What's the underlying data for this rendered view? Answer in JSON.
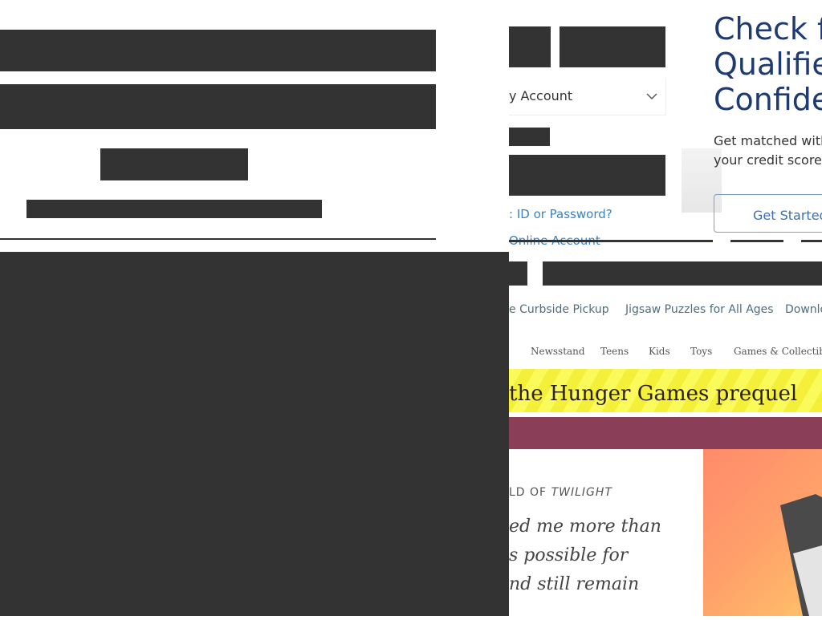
{
  "account_select": {
    "value": "y Account"
  },
  "links": {
    "forgot": ": ID or Password?",
    "create": "Online Account"
  },
  "ad": {
    "title_lines": [
      "Check fo",
      "Qualified",
      "Confide"
    ],
    "body_lines": [
      "Get matched with g",
      "your credit score."
    ],
    "cta": "Get Started"
  },
  "nav_primary": [
    "e Curbside Pickup",
    "Jigsaw Puzzles for All Ages",
    "Downlo"
  ],
  "nav_secondary": [
    "Newsstand",
    "Teens",
    "Kids",
    "Toys",
    "Games & Collectibles"
  ],
  "banner": {
    "text": "the Hunger Games prequel"
  },
  "feature": {
    "kicker_prefix": "LD OF ",
    "kicker_em": "TWILIGHT",
    "quote_lines": [
      "ed me more than",
      "s possible for",
      "nd still remain"
    ]
  },
  "colors": {
    "redaction": "#333333",
    "link": "#3b82c4",
    "ad_title": "#1e3a6e",
    "banner_yellow": "#f4f03a",
    "maroon": "#8a3e58"
  }
}
